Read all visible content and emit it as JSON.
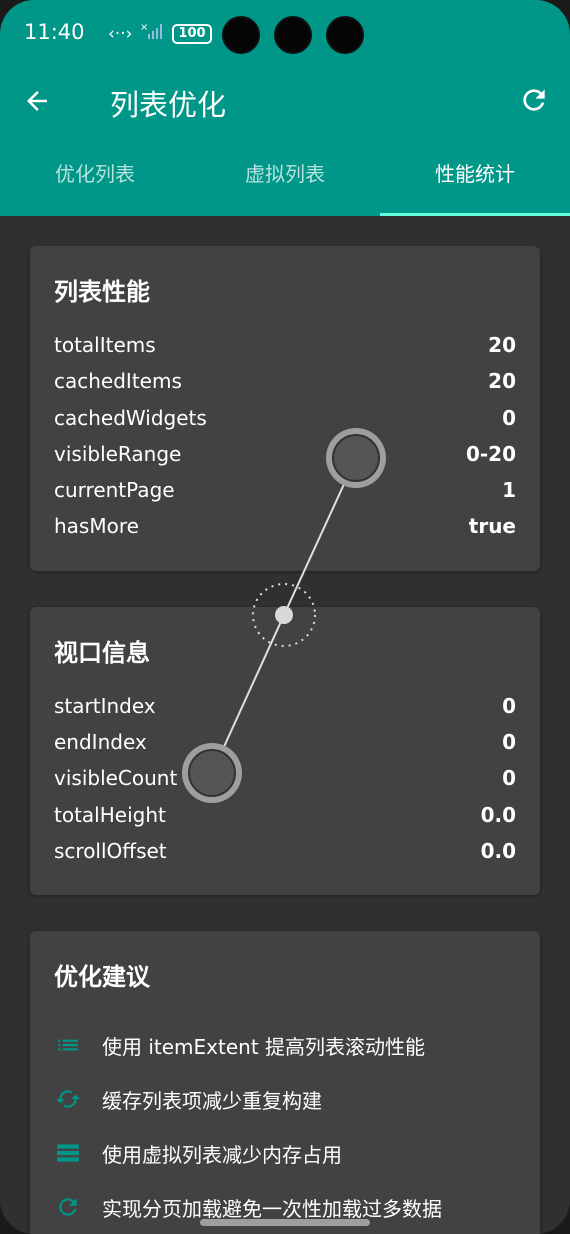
{
  "status": {
    "time": "11:40",
    "battery": "100"
  },
  "app": {
    "title": "列表优化"
  },
  "tabs": [
    {
      "label": "优化列表"
    },
    {
      "label": "虚拟列表"
    },
    {
      "label": "性能统计"
    }
  ],
  "performance": {
    "title": "列表性能",
    "rows": [
      {
        "key": "totalItems",
        "value": "20"
      },
      {
        "key": "cachedItems",
        "value": "20"
      },
      {
        "key": "cachedWidgets",
        "value": "0"
      },
      {
        "key": "visibleRange",
        "value": "0-20"
      },
      {
        "key": "currentPage",
        "value": "1"
      },
      {
        "key": "hasMore",
        "value": "true"
      }
    ]
  },
  "viewport": {
    "title": "视口信息",
    "rows": [
      {
        "key": "startIndex",
        "value": "0"
      },
      {
        "key": "endIndex",
        "value": "0"
      },
      {
        "key": "visibleCount",
        "value": "0"
      },
      {
        "key": "totalHeight",
        "value": "0.0"
      },
      {
        "key": "scrollOffset",
        "value": "0.0"
      }
    ]
  },
  "suggestions": {
    "title": "优化建议",
    "items": [
      {
        "icon": "list-icon",
        "text": "使用 itemExtent 提高列表滚动性能"
      },
      {
        "icon": "cached-icon",
        "text": "缓存列表项减少重复构建"
      },
      {
        "icon": "storage-icon",
        "text": "使用虚拟列表减少内存占用"
      },
      {
        "icon": "refresh-icon",
        "text": "实现分页加载避免一次性加载过多数据"
      }
    ]
  },
  "colors": {
    "appbar": "#009688",
    "accent": "#64ffda",
    "card": "#424242",
    "background": "#303030",
    "icon": "#009688"
  }
}
